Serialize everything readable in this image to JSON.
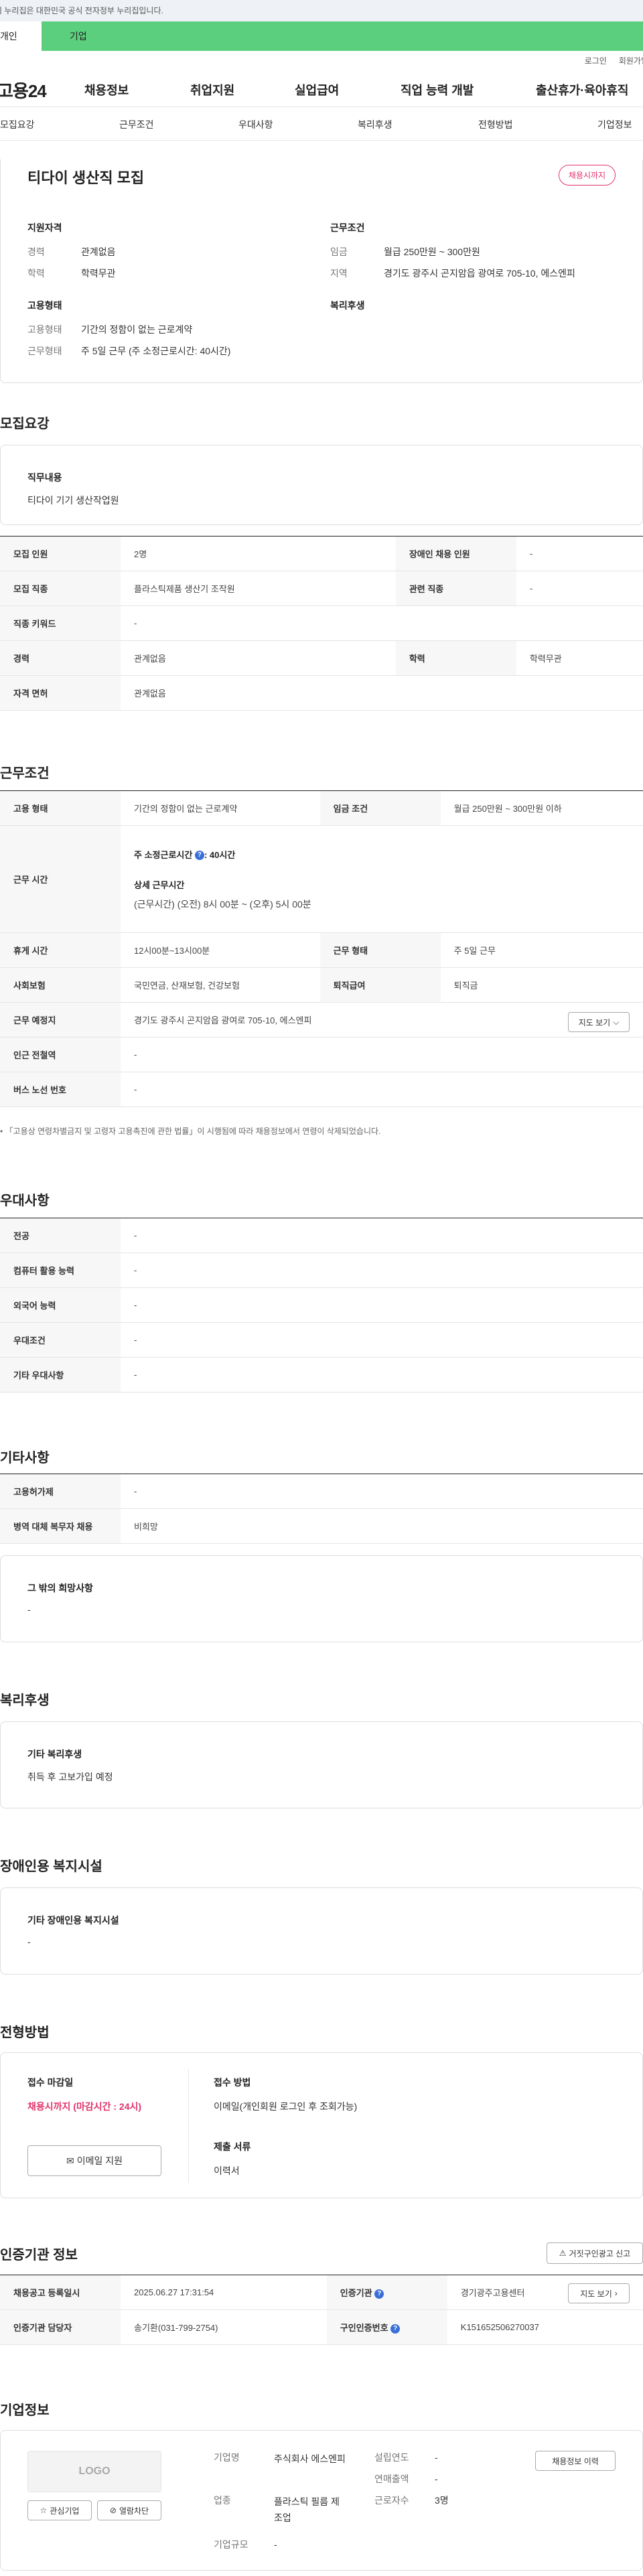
{
  "gov_banner": "이 누리집은 대한민국 공식 전자정부 누리집입니다.",
  "site_tabs": {
    "personal": "개인",
    "business": "기업"
  },
  "util": {
    "login": "로그인",
    "join": "회원가입"
  },
  "gnb": {
    "logo": "고용24",
    "items": [
      "채용정보",
      "취업지원",
      "실업급여",
      "직업 능력 개발",
      "출산휴가·육아휴직"
    ]
  },
  "anchors": [
    "모집요강",
    "근무조건",
    "우대사항",
    "복리후생",
    "전형방법",
    "기업정보"
  ],
  "job": {
    "title": "티다이 생산직 모집",
    "badge": "채용시까지",
    "qualification_h": "지원자격",
    "career_k": "경력",
    "career_v": "관계없음",
    "edu_k": "학력",
    "edu_v": "학력무관",
    "employ_h": "고용형태",
    "emp_type_k": "고용형태",
    "emp_type_v": "기간의 정함이 없는 근로계약",
    "work_type_k": "근무형태",
    "work_type_v": "주 5일 근무 (주 소정근로시간: 40시간)",
    "cond_h": "근무조건",
    "wage_k": "임금",
    "wage_v": "월급 250만원 ~ 300만원",
    "region_k": "지역",
    "region_v": "경기도 광주시 곤지암읍 광여로 705-10, 에스엔피",
    "welfare_h": "복리후생"
  },
  "recruit": {
    "heading": "모집요강",
    "duty_h": "직무내용",
    "duty_v": "티다이 기기 생산작업원",
    "rows": [
      {
        "k1": "모집 인원",
        "v1": "2명",
        "k2": "장애인 채용 인원",
        "v2": "-"
      },
      {
        "k1": "모집 직종",
        "v1": "플라스틱제품 생산기 조작원",
        "k2": "관련 직종",
        "v2": "-"
      },
      {
        "k1": "직종 키워드",
        "v1": "-"
      },
      {
        "k1": "경력",
        "v1": "관계없음",
        "k2": "학력",
        "v2": "학력무관"
      },
      {
        "k1": "자격 면허",
        "v1": "관계없음"
      }
    ]
  },
  "work": {
    "heading": "근무조건",
    "emp_k": "고용 형태",
    "emp_v": "기간의 정함이 없는 근로계약",
    "wage_k": "임금 조건",
    "wage_v": "월급 250만원 ~ 300만원 이하",
    "hours_k": "근무 시간",
    "hours_week": "주 소정근로시간",
    "hours_week_v": ": 40시간",
    "hours_detail_h": "상세 근무시간",
    "hours_detail_v": "(근무시간) (오전) 8시 00분 ~ (오후) 5시 00분",
    "break_k": "휴게 시간",
    "break_v": "12시00분~13시00분",
    "form_k": "근무 형태",
    "form_v": "주 5일 근무",
    "ins_k": "사회보험",
    "ins_v": "국민연금, 산재보험, 건강보험",
    "ret_k": "퇴직급여",
    "ret_v": "퇴직금",
    "place_k": "근무 예정지",
    "place_v": "경기도 광주시 곤지암읍 광여로 705-10, 에스엔피",
    "map_btn": "지도 보기",
    "subway_k": "인근 전철역",
    "subway_v": "-",
    "bus_k": "버스 노선 번호",
    "bus_v": "-",
    "note": "「고용상 연령차별금지 및 고령자 고용촉진에 관한 법률」이 시행됨에 따라 채용정보에서 연령이 삭제되었습니다."
  },
  "pref": {
    "heading": "우대사항",
    "rows": [
      {
        "k": "전공",
        "v": "-"
      },
      {
        "k": "컴퓨터 활용 능력",
        "v": "-"
      },
      {
        "k": "외국어 능력",
        "v": "-"
      },
      {
        "k": "우대조건",
        "v": "-"
      },
      {
        "k": "기타 우대사항",
        "v": "-"
      }
    ]
  },
  "etc": {
    "heading": "기타사항",
    "rows": [
      {
        "k": "고용허가제",
        "v": "-"
      },
      {
        "k": "병역 대체 복무자 채용",
        "v": "비희망"
      }
    ],
    "extra_h": "그 밖의 희망사항",
    "extra_v": "-"
  },
  "welfare": {
    "heading": "복리후생",
    "sub_h": "기타 복리후생",
    "sub_v": "취득 후 고보가입 예정"
  },
  "disabled": {
    "heading": "장애인용 복지시설",
    "sub_h": "기타 장애인용 복지시설",
    "sub_v": "-"
  },
  "selection": {
    "heading": "전형방법",
    "deadline_h": "접수 마감일",
    "deadline_v": "채용시까지 (마감시간 : 24시)",
    "email_btn": "이메일 지원",
    "method_h": "접수 방법",
    "method_v": "이메일(개인회원 로그인 후 조회가능)",
    "docs_h": "제출 서류",
    "docs_v": "이력서"
  },
  "cert": {
    "heading": "인증기관 정보",
    "report_btn": "거짓구인광고 신고",
    "reg_k": "채용공고 등록일시",
    "reg_v": "2025.06.27 17:31:54",
    "org_k": "인증기관",
    "org_v": "경기광주고용센터",
    "map_btn": "지도 보기",
    "mgr_k": "인증기관 담당자",
    "mgr_v": "송기환(031-799-2754)",
    "no_k": "구인인증번호",
    "no_v": "K151652506270037"
  },
  "company": {
    "heading": "기업정보",
    "logo": "LOGO",
    "fav_btn": "관심기업",
    "block_btn": "열람차단",
    "name_k": "기업명",
    "name_v": "주식회사 에스엔피",
    "industry_k": "업종",
    "industry_v": "플라스틱 필름 제조업",
    "size_k": "기업규모",
    "size_v": "-",
    "founded_k": "설립연도",
    "founded_v": "-",
    "sales_k": "연매출액",
    "sales_v": "-",
    "staff_k": "근로자수",
    "staff_v": "3명",
    "history_btn": "채용정보 이력"
  }
}
